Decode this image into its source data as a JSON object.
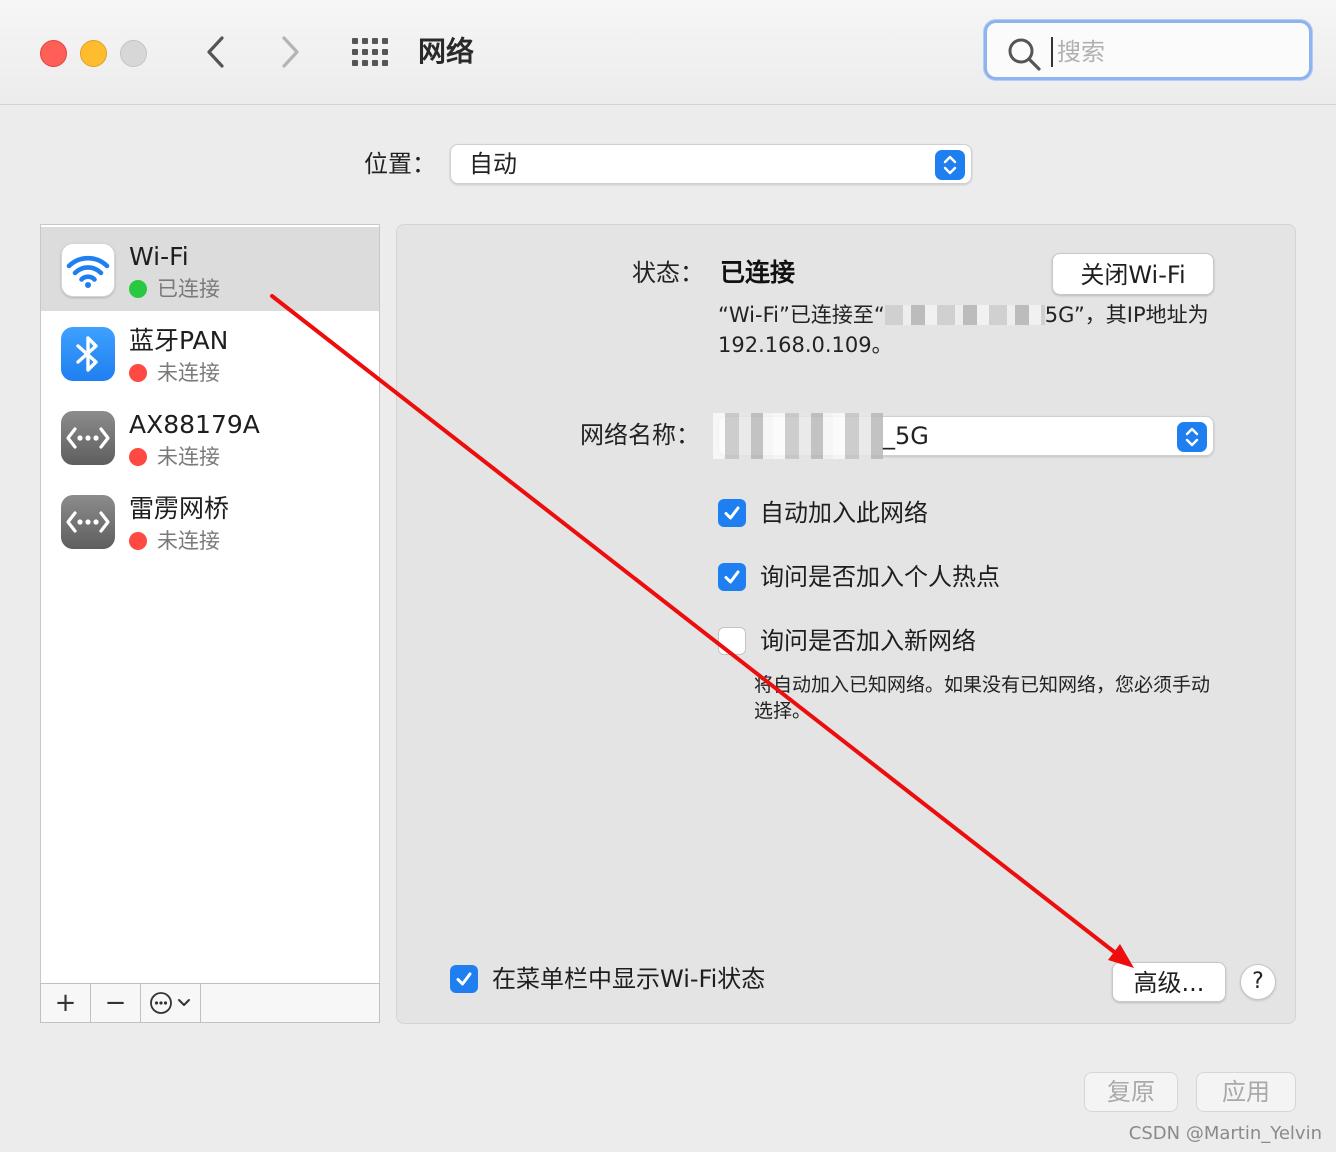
{
  "window": {
    "title": "网络"
  },
  "search": {
    "placeholder": "搜索",
    "value": ""
  },
  "location": {
    "label": "位置：",
    "value": "自动"
  },
  "services": [
    {
      "name": "Wi-Fi",
      "status": "已连接",
      "status_color": "#28c840",
      "icon": "wifi-icon"
    },
    {
      "name": "蓝牙PAN",
      "status": "未连接",
      "status_color": "#fe4a43",
      "icon": "bluetooth-icon"
    },
    {
      "name": "AX88179A",
      "status": "未连接",
      "status_color": "#fe4a43",
      "icon": "ethernet-icon"
    },
    {
      "name": "雷雳网桥",
      "status": "未连接",
      "status_color": "#fe4a43",
      "icon": "ethernet-icon"
    }
  ],
  "toolbar": {
    "add_label": "+",
    "remove_label": "−"
  },
  "detail": {
    "status_label": "状态：",
    "status_value": "已连接",
    "wifi_off_label": "关闭Wi-Fi",
    "status_desc_prefix": "“Wi-Fi”已连接至“",
    "status_desc_suffix": "5G”，其IP地址为192.168.0.109。",
    "network_name_label": "网络名称：",
    "network_name_suffix": "_5G",
    "checks": [
      {
        "label": "自动加入此网络",
        "checked": true
      },
      {
        "label": "询问是否加入个人热点",
        "checked": true
      },
      {
        "label": "询问是否加入新网络",
        "checked": false
      }
    ],
    "hint": "将自动加入已知网络。如果没有已知网络，您必须手动选择。",
    "menubar_check_label": "在菜单栏中显示Wi-Fi状态",
    "advanced_label": "高级...",
    "help_label": "?"
  },
  "footer": {
    "revert_label": "复原",
    "apply_label": "应用"
  },
  "watermark": "CSDN @Martin_Yelvin",
  "colors": {
    "accent": "#1f7ff0",
    "arrow": "#ee0d0d"
  }
}
